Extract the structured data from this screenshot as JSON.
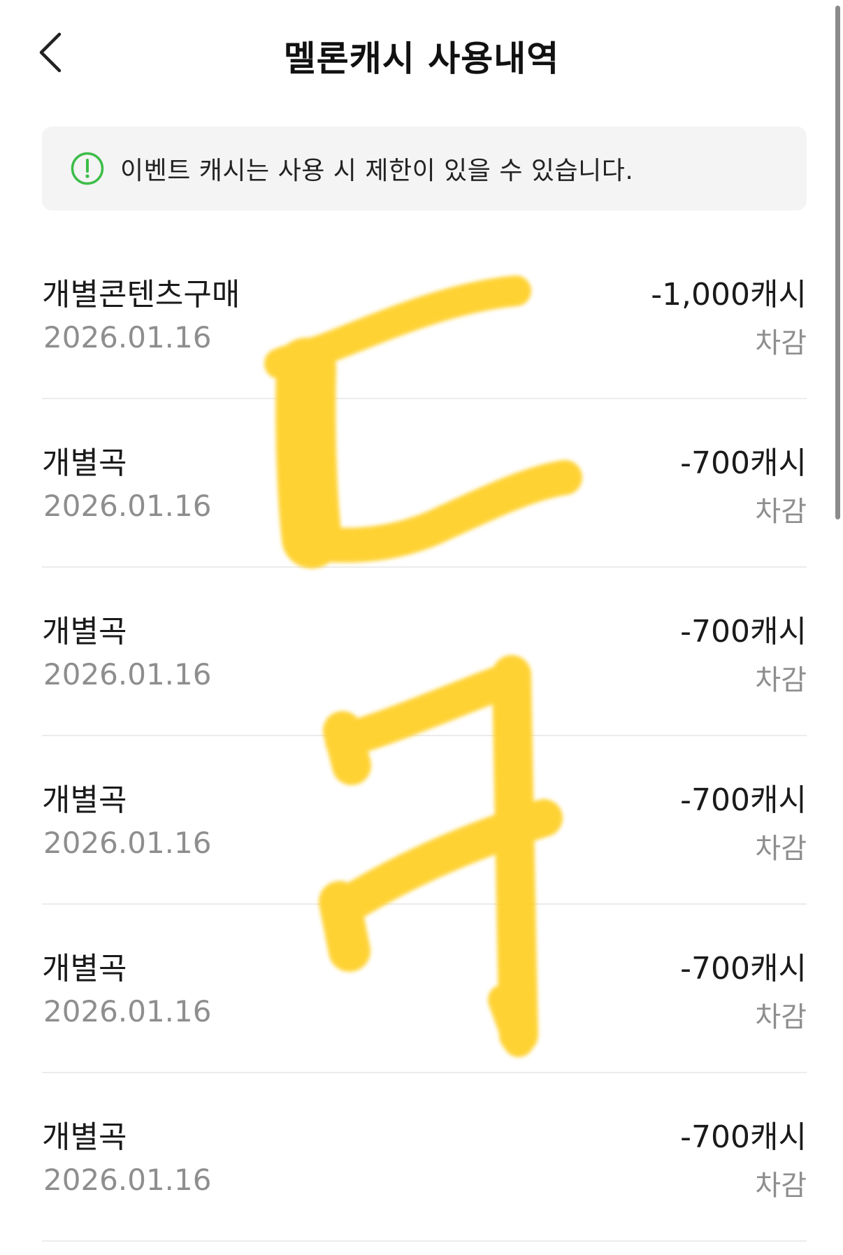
{
  "header": {
    "title": "멜론캐시 사용내역",
    "back_icon": "chevron-left-icon"
  },
  "notice": {
    "icon": "alert-circle-icon",
    "icon_color": "#3dbd48",
    "text": "이벤트 캐시는 사용 시 제한이 있을 수 있습니다."
  },
  "history": [
    {
      "title": "개별콘텐츠구매",
      "date": "2026.01.16",
      "amount": "-1,000캐시",
      "status": "차감"
    },
    {
      "title": "개별곡",
      "date": "2026.01.16",
      "amount": "-700캐시",
      "status": "차감"
    },
    {
      "title": "개별곡",
      "date": "2026.01.16",
      "amount": "-700캐시",
      "status": "차감"
    },
    {
      "title": "개별곡",
      "date": "2026.01.16",
      "amount": "-700캐시",
      "status": "차감"
    },
    {
      "title": "개별곡",
      "date": "2026.01.16",
      "amount": "-700캐시",
      "status": "차감"
    },
    {
      "title": "개별곡",
      "date": "2026.01.16",
      "amount": "-700캐시",
      "status": "차감"
    }
  ],
  "colors": {
    "scribble": "#ffd02a",
    "divider": "#ececec",
    "secondary_text": "#8e8e8e"
  }
}
